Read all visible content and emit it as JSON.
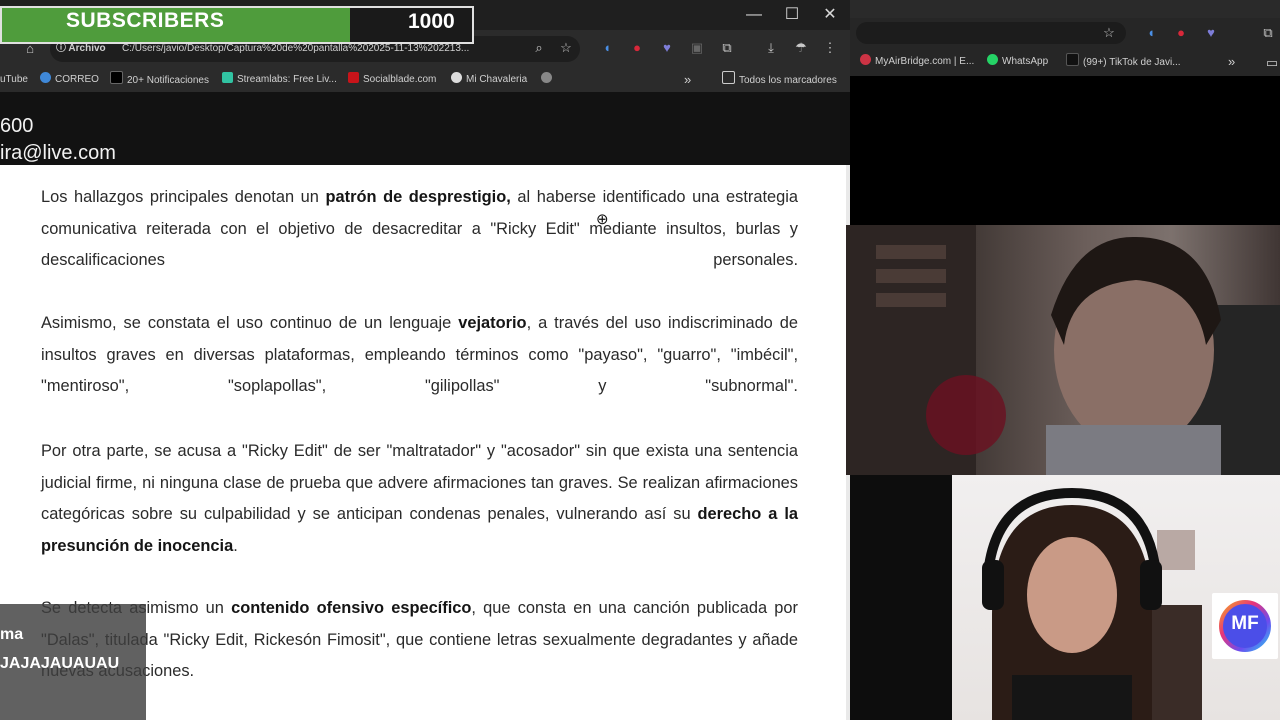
{
  "overlay": {
    "label": "SUBSCRIBERS",
    "count": "1000",
    "progress": 0.74
  },
  "browser": {
    "window_controls": {
      "minimize": "—",
      "maximize": "☐",
      "close": "✕"
    },
    "address": {
      "chip": "Archivo",
      "url": "C:/Users/javio/Desktop/Captura%20de%20pantalla%202025-11-13%202213..."
    },
    "bookmarks": [
      {
        "label": "uTube",
        "color": "#e02020"
      },
      {
        "label": "CORREO",
        "color": "#3f88d8"
      },
      {
        "label": "20+ Notificaciones",
        "color": "#111111"
      },
      {
        "label": "Streamlabs: Free Liv...",
        "color": "#31c3a2"
      },
      {
        "label": "Socialblade.com",
        "color": "#c8141a"
      },
      {
        "label": "Mi Chavaleria",
        "color": "#dddddd"
      },
      {
        "label": "",
        "color": "#888888"
      }
    ],
    "all_bookmarks": "Todos los marcadores"
  },
  "right_browser": {
    "bookmarks": [
      {
        "label": "MyAirBridge.com | E...",
        "color": "#cc3344"
      },
      {
        "label": "WhatsApp",
        "color": "#25d366"
      },
      {
        "label": "(99+) TikTok de Javi...",
        "color": "#111111"
      }
    ]
  },
  "document": {
    "contact_number": "600",
    "contact_email": "ira@live.com",
    "p1": {
      "a": "Los hallazgos principales denotan un ",
      "b": "patrón de desprestigio,",
      "c": " al haberse identificado una estrategia comunicativa reiterada con el objetivo de desacreditar a \"Ricky Edit\" mediante insultos, burlas y descalificaciones personales."
    },
    "p2": {
      "a": "Asimismo, se constata el uso continuo de un lenguaje ",
      "b": "vejatorio",
      "c": ", a través del uso indiscriminado de  insultos graves en diversas plataformas, empleando términos como \"payaso\", \"guarro\", \"imbécil\", \"mentiroso\", \"soplapollas\", \"gilipollas\" y \"subnormal\"."
    },
    "p3": {
      "a": "Por otra parte, se acusa a \"Ricky Edit\" de ser \"maltratador\" y \"acosador\" sin que exista una sentencia judicial firme, ni ninguna clase de prueba que advere afirmaciones tan graves. Se realizan afirmaciones categóricas sobre su culpabilidad y se anticipan condenas penales, vulnerando así su ",
      "b": "derecho a la presunción de inocencia",
      "c": "."
    },
    "p4": {
      "a": "Se detecta asimismo un ",
      "b": "contenido ofensivo específico",
      "c": ", que consta en una canción publicada por \"Dalas\", titulada \"Ricky Edit, Rickesón Fimosit\", que contiene letras sexualmente degradantes y añade nuevas acusaciones."
    }
  },
  "chat": {
    "name": "ma",
    "message": "JAJAJAUAUAU"
  },
  "logo": {
    "text": "MF"
  }
}
